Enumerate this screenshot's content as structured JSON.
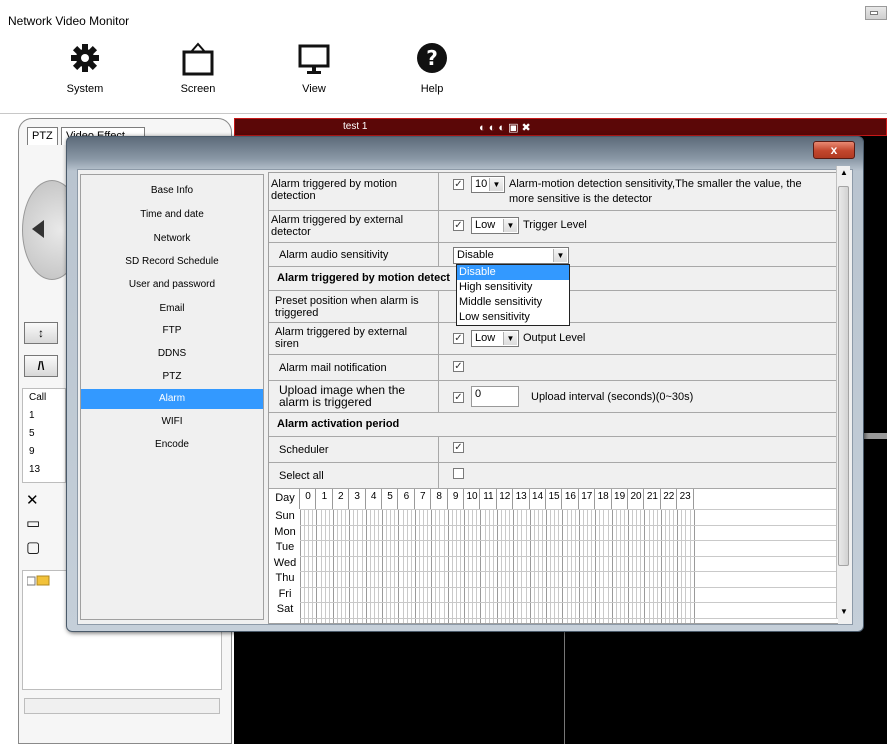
{
  "app": {
    "title": "Network Video Monitor"
  },
  "toolbar": {
    "items": [
      {
        "label": "System",
        "icon": "gear-icon"
      },
      {
        "label": "Screen",
        "icon": "screen-icon"
      },
      {
        "label": "View",
        "icon": "monitor-icon"
      },
      {
        "label": "Help",
        "icon": "help-icon"
      }
    ]
  },
  "left_panel": {
    "tabs": [
      "PTZ",
      "Video Effect"
    ],
    "call_label": "Call",
    "call_numbers": [
      "1",
      "5",
      "9",
      "13"
    ]
  },
  "video": {
    "title": "test 1"
  },
  "dialog": {
    "close_label": "x",
    "nav": [
      "Base Info",
      "Time and date",
      "Network",
      "SD Record Schedule",
      "User and password",
      "Email",
      "FTP",
      "DDNS",
      "PTZ",
      "Alarm",
      "WIFI",
      "Encode"
    ],
    "active_nav": "Alarm",
    "form": {
      "motion_label": "Alarm triggered by motion detection",
      "motion_sensitivity": "10",
      "motion_note": "Alarm-motion detection sensitivity,The smaller the value, the more sensitive is the detector",
      "external_label": "Alarm triggered by external detector",
      "external_level": "Low",
      "external_note": "Trigger Level",
      "audio_label": "Alarm audio sensitivity",
      "audio_value": "Disable",
      "audio_options": [
        "Disable",
        "High sensitivity",
        "Middle sensitivity",
        "Low sensitivity"
      ],
      "motion_section": "Alarm triggered by motion detect",
      "preset_label": "Preset position when alarm is triggered",
      "siren_label": "Alarm triggered by external siren",
      "siren_level": "Low",
      "siren_note": "Output Level",
      "mail_label": "Alarm mail notification",
      "upload_label": "Upload image when the alarm is triggered",
      "upload_value": "0",
      "upload_note": "Upload interval (seconds)(0~30s)",
      "period_section": "Alarm activation period",
      "scheduler_label": "Scheduler",
      "selectall_label": "Select all"
    },
    "schedule": {
      "day_header": "Day",
      "hours": [
        "0",
        "1",
        "2",
        "3",
        "4",
        "5",
        "6",
        "7",
        "8",
        "9",
        "10",
        "11",
        "12",
        "13",
        "14",
        "15",
        "16",
        "17",
        "18",
        "19",
        "20",
        "21",
        "22",
        "23"
      ],
      "days": [
        "Sun",
        "Mon",
        "Tue",
        "Wed",
        "Thu",
        "Fri",
        "Sat"
      ]
    }
  }
}
